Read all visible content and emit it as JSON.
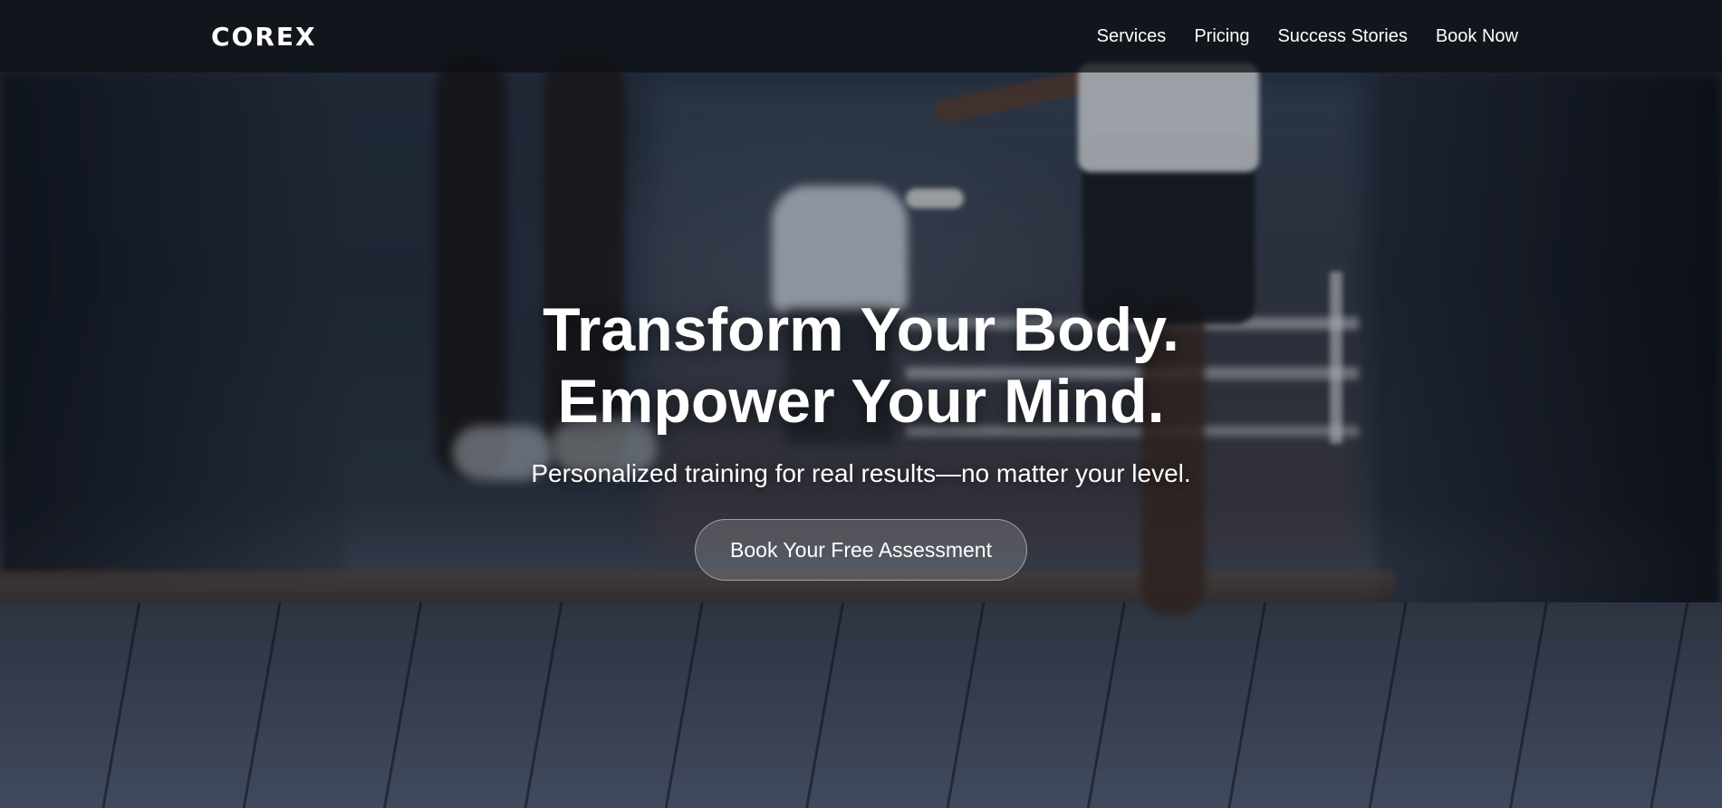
{
  "brand": {
    "logo_text": "COREX"
  },
  "nav": {
    "links": [
      {
        "label": "Services"
      },
      {
        "label": "Pricing"
      },
      {
        "label": "Success Stories"
      },
      {
        "label": "Book Now"
      }
    ]
  },
  "hero": {
    "headline_line1": "Transform Your Body.",
    "headline_line2": "Empower Your Mind.",
    "subheadline": "Personalized training for real results—no matter your level.",
    "cta_label": "Book Your Free Assessment",
    "background_description_icon": "gym-photo-background"
  },
  "colors": {
    "text": "#ffffff",
    "navbar_bg": "#0c0e12",
    "button_border": "#ffffff"
  }
}
